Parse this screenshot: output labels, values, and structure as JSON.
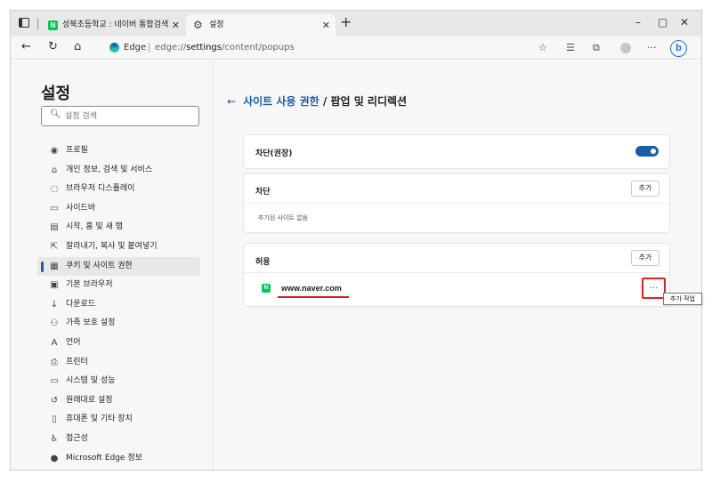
{
  "tabs": [
    {
      "label": "성북초등학교 : 네이버 통합검색",
      "favicon": "naver-icon"
    },
    {
      "label": "설정",
      "favicon": "gear-icon",
      "active": true
    }
  ],
  "window_controls": {
    "minimize": "–",
    "maximize": "▢",
    "close": "✕"
  },
  "address_bar": {
    "site_label": "Edge",
    "url_prefix": "edge://",
    "url_host": "settings",
    "url_path": "/content/popups"
  },
  "sidebar": {
    "title": "설정",
    "search_placeholder": "설정 검색",
    "items": [
      {
        "label": "프로필",
        "icon": "profile-icon"
      },
      {
        "label": "개인 정보, 검색 및 서비스",
        "icon": "lock-icon"
      },
      {
        "label": "브라우저 디스플레이",
        "icon": "palette-icon"
      },
      {
        "label": "사이드바",
        "icon": "sidebar-icon"
      },
      {
        "label": "시작, 홈 및 새 탭",
        "icon": "home-icon"
      },
      {
        "label": "잘라내기, 복사 및 붙여넣기",
        "icon": "share-icon"
      },
      {
        "label": "쿠키 및 사이트 권한",
        "icon": "cookie-icon",
        "active": true
      },
      {
        "label": "기본 브라우저",
        "icon": "browser-icon"
      },
      {
        "label": "다운로드",
        "icon": "download-icon"
      },
      {
        "label": "가족 보호 설정",
        "icon": "family-icon"
      },
      {
        "label": "언어",
        "icon": "language-icon"
      },
      {
        "label": "프린터",
        "icon": "printer-icon"
      },
      {
        "label": "시스템 및 성능",
        "icon": "laptop-icon"
      },
      {
        "label": "원래대로 설정",
        "icon": "reset-icon"
      },
      {
        "label": "휴대폰 및 기타 장치",
        "icon": "phone-icon"
      },
      {
        "label": "접근성",
        "icon": "accessibility-icon"
      },
      {
        "label": "Microsoft Edge 정보",
        "icon": "edge-icon"
      }
    ]
  },
  "main": {
    "back_arrow": "←",
    "breadcrumb": "사이트 사용 권한",
    "separator": " / ",
    "title": "팝업 및 리디렉션",
    "blocked_recommended": {
      "label": "차단(권장)",
      "enabled": true
    },
    "block": {
      "title": "차단",
      "add_label": "추가",
      "empty_text": "추가된 사이트 없음"
    },
    "allow": {
      "title": "허용",
      "add_label": "추가",
      "sites": [
        {
          "name": "www.naver.com",
          "favicon": "naver-icon"
        }
      ],
      "more_label": "···",
      "tooltip": "추가 작업"
    }
  },
  "colors": {
    "accent": "#1a5ea8",
    "highlight": "#e02020",
    "naver": "#03c75a"
  }
}
